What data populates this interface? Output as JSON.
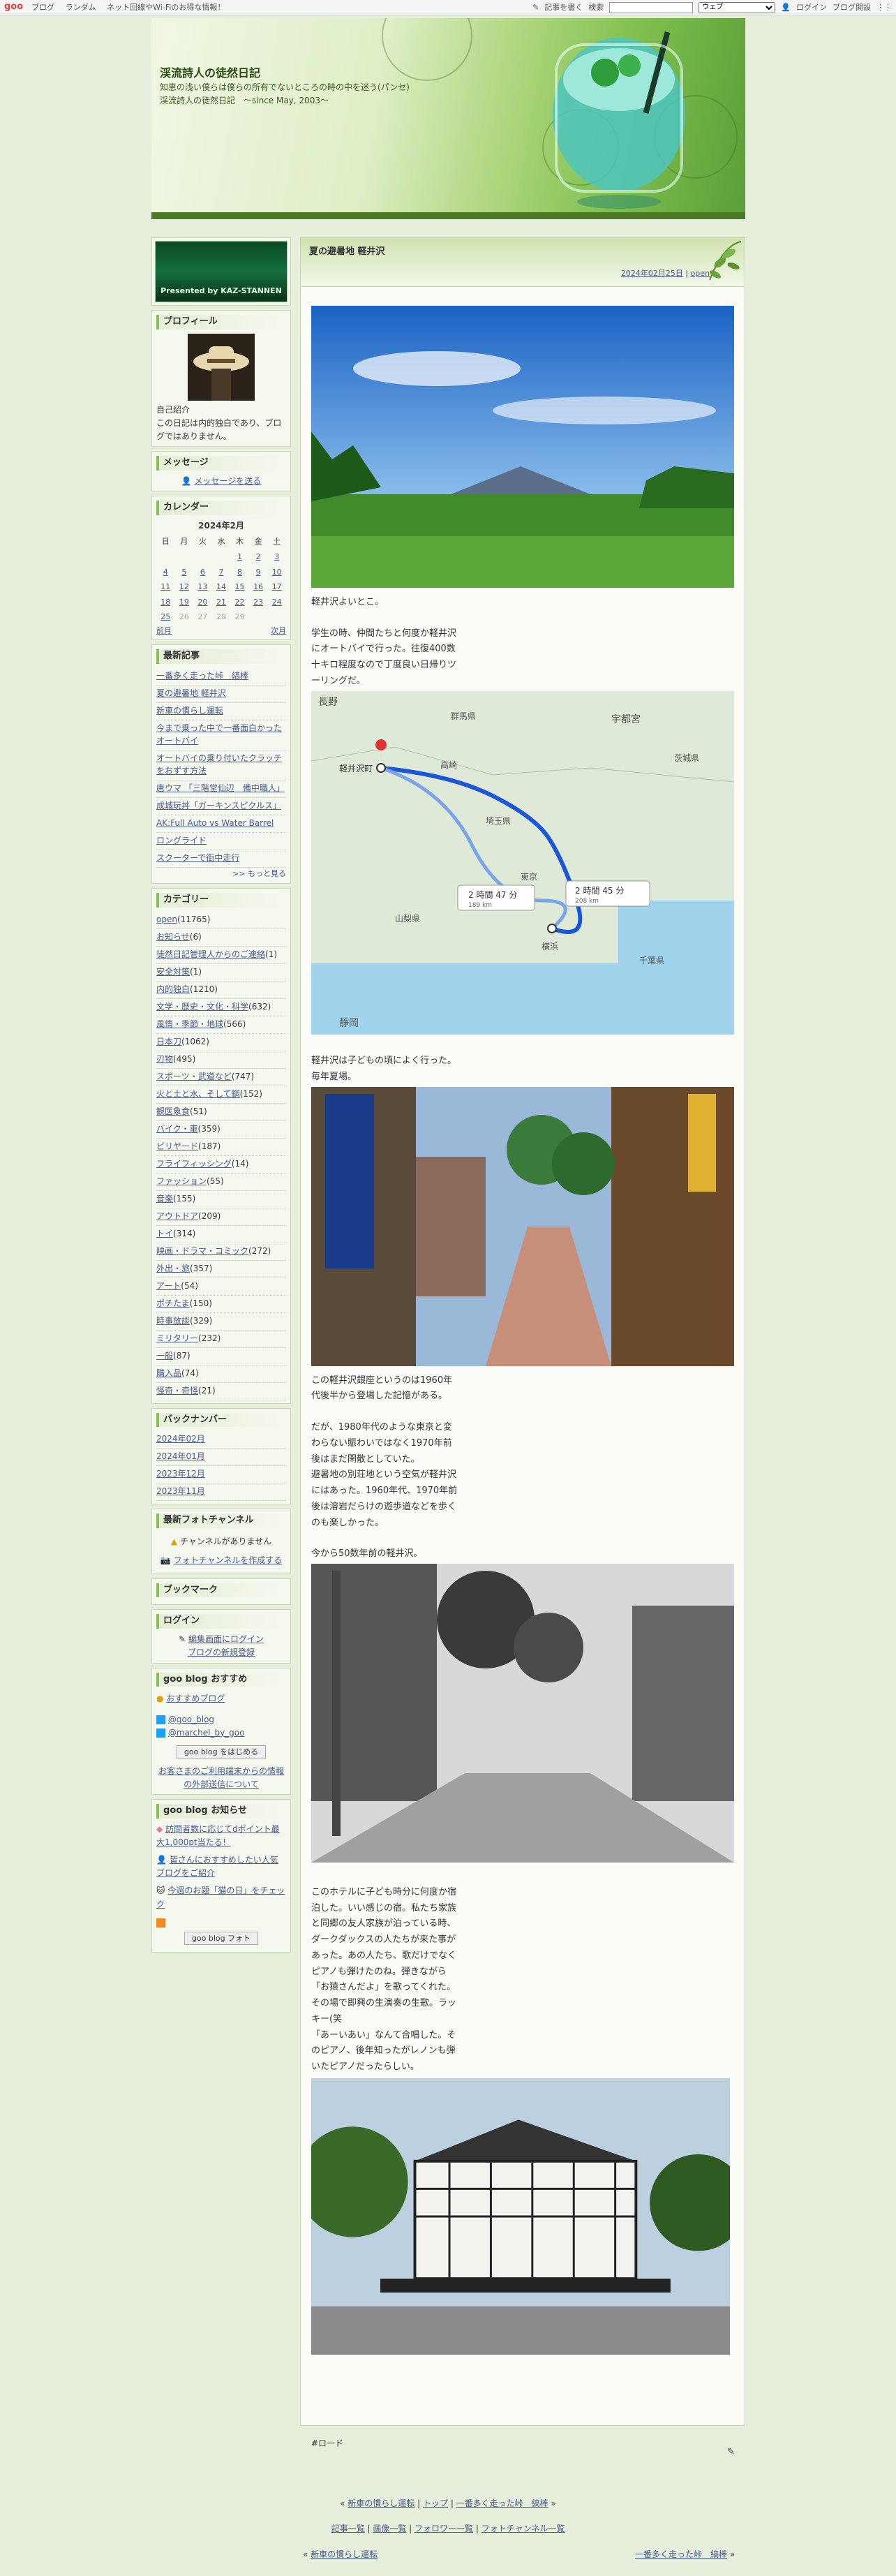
{
  "topbar": {
    "logo": "goo",
    "links": [
      "ブログ",
      "ランダム",
      "ネット回線やWi-Fiのお得な情報！"
    ],
    "write": "記事を書く",
    "search_label": "検索",
    "scope": "ウェブ",
    "login": "ログイン",
    "open_blog": "ブログ開設"
  },
  "header": {
    "title": "渓流詩人の徒然日記",
    "desc": "知恵の浅い僕らは僕らの所有でないところの時の中を迷う(パンセ)　渓流詩人の徒然日記　～since May, 2003～"
  },
  "sidebar": {
    "banner": "Presented by KAZ-STANNEN",
    "profile": {
      "title": "プロフィール",
      "intro": "自己紹介",
      "text": "この日記は内的独白であり、ブログではありません。"
    },
    "message": {
      "title": "メッセージ",
      "link": "メッセージを送る"
    },
    "calendar": {
      "title": "カレンダー",
      "month": "2024年2月",
      "dows": [
        "日",
        "月",
        "火",
        "水",
        "木",
        "金",
        "土"
      ],
      "rows": [
        [
          "",
          "",
          "",
          "",
          "1",
          "2",
          "3"
        ],
        [
          "4",
          "5",
          "6",
          "7",
          "8",
          "9",
          "10"
        ],
        [
          "11",
          "12",
          "13",
          "14",
          "15",
          "16",
          "17"
        ],
        [
          "18",
          "19",
          "20",
          "21",
          "22",
          "23",
          "24"
        ],
        [
          "25",
          "26",
          "27",
          "28",
          "29",
          "",
          ""
        ]
      ],
      "prev": "前月",
      "next": "次月"
    },
    "recent": {
      "title": "最新記事",
      "items": [
        "一番多く走った峠　縞棒",
        "夏の避暑地 軽井沢",
        "新車の慣らし運転",
        "今まで乗った中で一番面白かったオートバイ",
        "オートバイの乗り付いたクラッチをおずす方法",
        "唐ウマ 「三階堂仙辺　備中職人」",
        "成城玩丼「ガーキンスピクルス」",
        "AK:Full Auto vs Water Barrel",
        "ロングライド",
        "スクーターで街中走行"
      ],
      "more": ">> もっと見る"
    },
    "category": {
      "title": "カテゴリー",
      "items": [
        [
          "open",
          "(11765)"
        ],
        [
          "お知らせ",
          "(6)"
        ],
        [
          "徒然日記管理人からのご連絡",
          "(1)"
        ],
        [
          "安全対策",
          "(1)"
        ],
        [
          "内的独白",
          "(1210)"
        ],
        [
          "文学・歴史・文化・科学",
          "(632)"
        ],
        [
          "風情・季節・地球",
          "(566)"
        ],
        [
          "日本刀",
          "(1062)"
        ],
        [
          "刃物",
          "(495)"
        ],
        [
          "スポーツ・武道など",
          "(747)"
        ],
        [
          "火と土と水、そして鋼",
          "(152)"
        ],
        [
          "観医象食",
          "(51)"
        ],
        [
          "バイク・車",
          "(359)"
        ],
        [
          "ビリヤード",
          "(187)"
        ],
        [
          "フライフィッシング",
          "(14)"
        ],
        [
          "ファッション",
          "(55)"
        ],
        [
          "音楽",
          "(155)"
        ],
        [
          "アウトドア",
          "(209)"
        ],
        [
          "トイ",
          "(314)"
        ],
        [
          "映画・ドラマ・コミック",
          "(272)"
        ],
        [
          "外出・旅",
          "(357)"
        ],
        [
          "アート",
          "(54)"
        ],
        [
          "ポチたま",
          "(150)"
        ],
        [
          "時事放談",
          "(329)"
        ],
        [
          "ミリタリー",
          "(232)"
        ],
        [
          "一般",
          "(87)"
        ],
        [
          "購入品",
          "(74)"
        ],
        [
          "怪奇・奇怪",
          "(21)"
        ]
      ]
    },
    "backnumber": {
      "title": "バックナンバー",
      "items": [
        "2024年02月",
        "2024年01月",
        "2023年12月",
        "2023年11月"
      ]
    },
    "photo": {
      "title": "最新フォトチャンネル",
      "empty": "チャンネルがありません",
      "create": "フォトチャンネルを作成する"
    },
    "bookmark": {
      "title": "ブックマーク"
    },
    "login": {
      "title": "ログイン",
      "edit": "編集画面にログイン",
      "new": "ブログの新規登録"
    },
    "recommend": {
      "title": "goo blog おすすめ",
      "link": "おすすめブログ",
      "twitter1": "@goo_blog",
      "twitter2": "@marchel_by_goo",
      "start": "goo blog をはじめる",
      "note": "お客さまのご利用端末からの情報の外部送信について"
    },
    "notice": {
      "title": "goo blog お知らせ",
      "items": [
        "訪問者数に応じてdポイント最大1,000pt当たる！",
        "皆さんにおすすめしたい人気ブログをご紹介",
        "今週のお題「猫の日」をチェック"
      ],
      "photo": "goo blog フォト"
    }
  },
  "post": {
    "title": "夏の避暑地 軽井沢",
    "date": "2024年02月25日",
    "category": "open",
    "p1": "軽井沢よいとこ。",
    "p2": "学生の時、仲間たちと何度か軽井沢にオートバイで行った。往復400数十キロ程度なので丁度良い日帰りツーリングだ。",
    "map": {
      "route1": "2 時間 47 分",
      "dist1": "189 km",
      "route2": "2 時間 45 分",
      "dist2": "208 km",
      "labels": [
        "長野",
        "宇都宮",
        "軽井沢町",
        "高崎",
        "埼玉県",
        "東京",
        "横浜",
        "千葉県",
        "静岡",
        "山梨県",
        "茨城県",
        "群馬県"
      ]
    },
    "p3": "軽井沢は子どもの頃によく行った。毎年夏場。",
    "p4": "この軽井沢銀座というのは1960年代後半から登場した記憶がある。",
    "p5": "だが、1980年代のような東京と変わらない賑わいではなく1970年前後はまだ閑散としていた。",
    "p6": "避暑地の別荘地という空気が軽井沢にはあった。1960年代、1970年前後は溶岩だらけの遊歩道などを歩くのも楽しかった。",
    "p7": "今から50数年前の軽井沢。",
    "p8": "このホテルに子ども時分に何度か宿泊した。いい感じの宿。私たち家族と同郷の友人家族が泊っている時、ダークダックスの人たちが来た事があった。あの人たち、歌だけでなくピアノも弾けたのね。弾きながら「お猿さんだよ」を歌ってくれた。その場で即興の生演奏の生歌。ラッキー(笑",
    "p9": "「あーいあい」なんて合唱した。そのピアノ、後年知ったがレノンも弾いたピアノだったらしい。",
    "tag": "#ロード"
  },
  "footer": {
    "prev": "新車の慣らし運転",
    "top": "トップ",
    "next": "一番多く走った峠　縞棒",
    "lists": [
      "記事一覧",
      "画像一覧",
      "フォロワー一覧",
      "フォトチャンネル一覧"
    ]
  }
}
